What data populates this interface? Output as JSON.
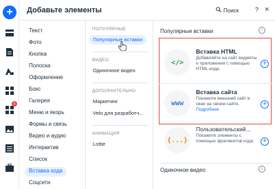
{
  "panel": {
    "title": "Добавьте элементы",
    "search_label": "Поиск",
    "help_label": "?",
    "close_label": "×"
  },
  "rail": {
    "add_label": "+",
    "badge_count": "1",
    "icons": [
      "menu-icon",
      "page-icon",
      "theme-icon",
      "apps-icon",
      "image-icon",
      "table-icon",
      "briefcase-icon"
    ]
  },
  "categories": [
    {
      "label": "Текст"
    },
    {
      "label": "Фото"
    },
    {
      "label": "Кнопка"
    },
    {
      "label": "Полоска"
    },
    {
      "label": "Оформление"
    },
    {
      "label": "Бокс"
    },
    {
      "label": "Галерея"
    },
    {
      "label": "Меню и якорь"
    },
    {
      "label": "Формы и связь"
    },
    {
      "label": "Видео и аудио"
    },
    {
      "label": "Интерактив"
    },
    {
      "label": "Список"
    },
    {
      "label": "Вставка кода"
    },
    {
      "label": "Соцсети"
    }
  ],
  "active_category": "Вставка кода",
  "subcategories": {
    "popular_header": "ПОПУЛЯРНЫЕ",
    "popular_item": "Популярные вставки",
    "video_header": "ВИДЕО",
    "video_item": "Одиночное видео",
    "extra_header": "ДОПОЛНИТЕЛЬНО",
    "extra_item1": "Маркетинг",
    "extra_item2": "Velo для разработч...",
    "anim_header": "АНИМАЦИЯ",
    "anim_item": "Lottie"
  },
  "content": {
    "section_title": "Популярные вставки",
    "info": "i",
    "items": [
      {
        "title": "Вставка HTML",
        "desc": "Добавляйте на сайт виджеты и приложения с помощью HTML-кода.",
        "icon_text": "</>",
        "icon": "code-icon",
        "link": ""
      },
      {
        "title": "Вставка сайта",
        "desc": "Покажите внешний сайт в окне на своем сайте.",
        "icon_text": "www",
        "icon": "globe-icon",
        "link": "Подробнее"
      },
      {
        "title": "Пользовательский...",
        "desc": "Покажите элементы с помощью фрагментов кода.",
        "icon_text": "{...}",
        "icon": "custom-element-icon",
        "link": ""
      }
    ],
    "add_label": "+",
    "bottom_title": "Одиночное видео"
  },
  "colors": {
    "accent": "#116dff",
    "highlight_border": "#e8473f",
    "html_icon": "#2f9e44",
    "www_icon": "#3a7bd5",
    "custom_icon": "#f08c00"
  }
}
